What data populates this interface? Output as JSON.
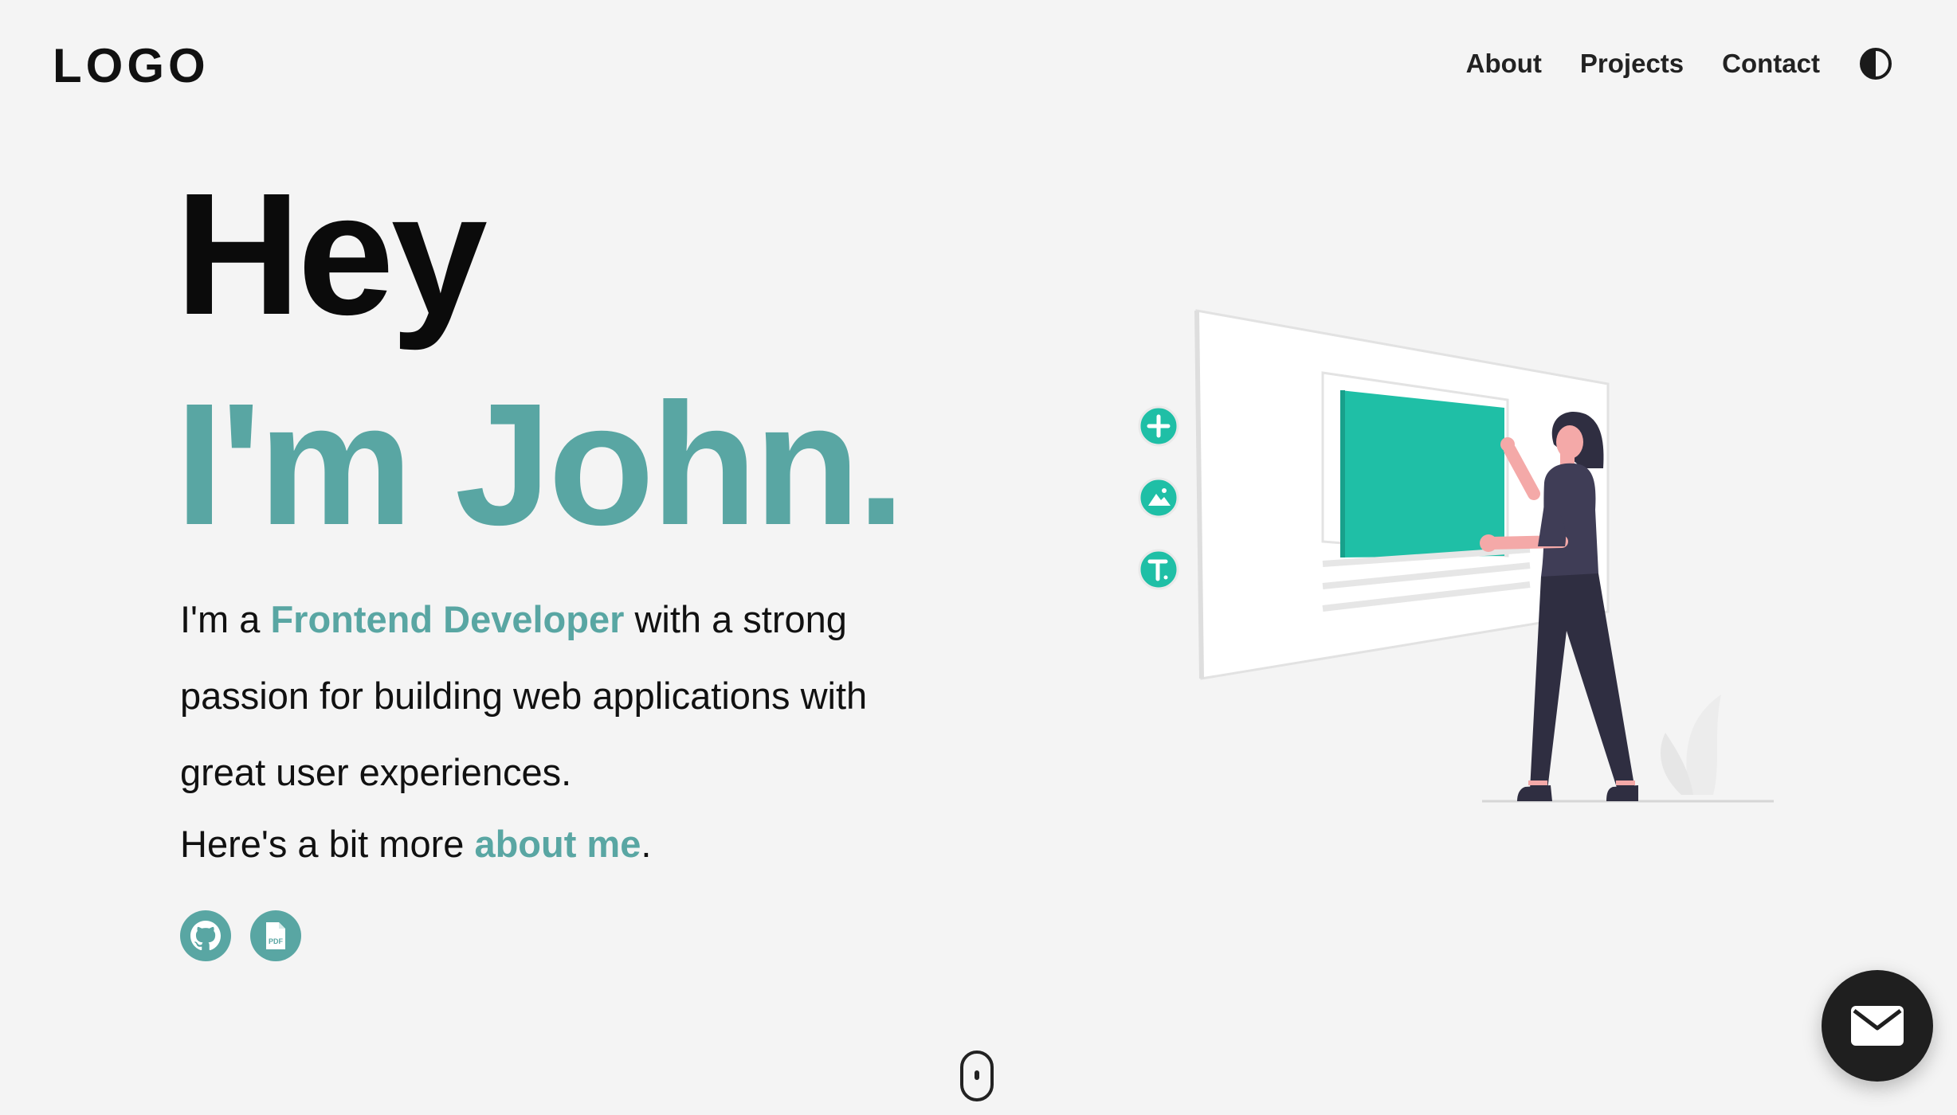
{
  "header": {
    "logo": "LOGO",
    "nav": [
      {
        "label": "About"
      },
      {
        "label": "Projects"
      },
      {
        "label": "Contact"
      }
    ],
    "theme_toggle_icon": "contrast-half-circle-icon"
  },
  "hero": {
    "greeting": "Hey",
    "name": "I'm John.",
    "intro_prefix": "I'm a ",
    "intro_role": "Frontend Developer",
    "intro_suffix": " with a strong passion for building web applications with great user experiences.",
    "more_prefix": "Here's a bit more ",
    "more_link": "about me",
    "more_suffix": "."
  },
  "social": [
    {
      "icon": "github-icon"
    },
    {
      "icon": "pdf-resume-icon"
    }
  ],
  "illustration": {
    "toolbar_icons": [
      "plus-icon",
      "image-icon",
      "text-icon"
    ]
  },
  "fab": {
    "icon": "mail-icon"
  },
  "scroll_icon": "mouse-scroll-icon",
  "colors": {
    "background": "#f4f4f4",
    "accent": "#59a6a3",
    "illustration_green": "#1fbfa6",
    "text": "#111111",
    "fab": "#1f1f1f"
  }
}
